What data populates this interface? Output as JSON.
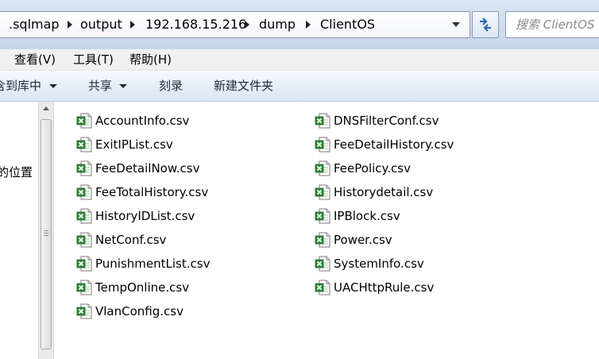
{
  "address_bar": {
    "crumbs": [
      ".sqlmap",
      "output",
      "192.168.15.216",
      "dump",
      "ClientOS"
    ],
    "search_placeholder": "搜索 ClientOS"
  },
  "menu": [
    "查看(V)",
    "工具(T)",
    "帮助(H)"
  ],
  "commands": {
    "include_library": "含到库中",
    "share": "共享",
    "burn": "刻录",
    "new_folder": "新建文件夹"
  },
  "nav": {
    "partial_label": "的位置"
  },
  "files": {
    "column1": [
      "AccountInfo.csv",
      "ExitIPList.csv",
      "FeeDetailNow.csv",
      "FeeTotalHistory.csv",
      "HistoryIDList.csv",
      "NetConf.csv",
      "PunishmentList.csv",
      "TempOnline.csv",
      "VlanConfig.csv"
    ],
    "column2": [
      "DNSFilterConf.csv",
      "FeeDetailHistory.csv",
      "FeePolicy.csv",
      "Historydetail.csv",
      "IPBlock.csv",
      "Power.csv",
      "SystemInfo.csv",
      "UACHttpRule.csv"
    ],
    "icon": "excel-csv-icon"
  },
  "colors": {
    "excel_green": "#2e8b3a",
    "toolbar_blue": "#dce7f4"
  }
}
